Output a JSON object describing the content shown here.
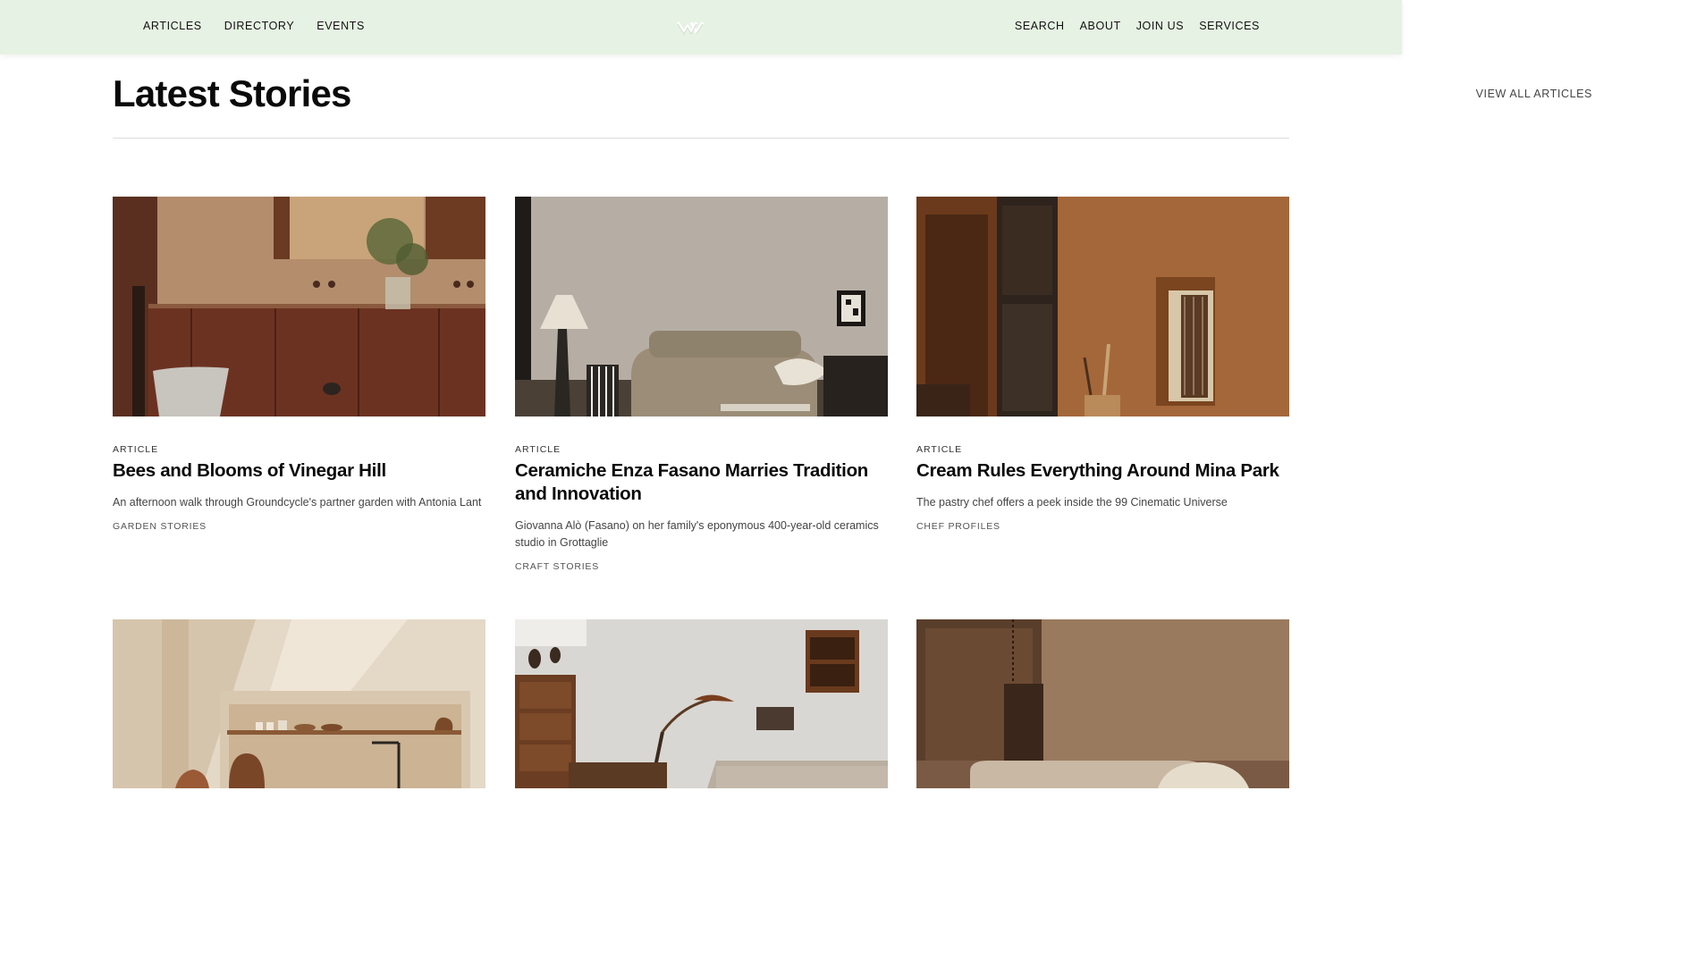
{
  "nav": {
    "left": [
      "ARTICLES",
      "DIRECTORY",
      "EVENTS"
    ],
    "right": [
      "SEARCH",
      "ABOUT",
      "JOIN US",
      "SERVICES"
    ],
    "logo_icon": "w-logo-icon",
    "bar_color": "#e6f2e3"
  },
  "header": {
    "title": "Latest Stories",
    "view_all": "VIEW ALL ARTICLES"
  },
  "cards": [
    {
      "kicker": "ARTICLE",
      "title": "Bees and Blooms of Vinegar Hill",
      "description": "An afternoon walk through Groundcycle's partner garden with Antonia Lant",
      "category": "GARDEN STORIES"
    },
    {
      "kicker": "ARTICLE",
      "title": "Ceramiche Enza Fasano Marries Tradition and Innovation",
      "description": "Giovanna Alò (Fasano) on her family's eponymous 400-year-old ceramics studio in Grottaglie",
      "category": "CRAFT STORIES"
    },
    {
      "kicker": "ARTICLE",
      "title": "Cream Rules Everything Around Mina Park",
      "description": "The pastry chef offers a peek inside the 99 Cinematic Universe",
      "category": "CHEF PROFILES"
    },
    {
      "kicker": "",
      "title": "",
      "description": "",
      "category": ""
    },
    {
      "kicker": "",
      "title": "",
      "description": "",
      "category": ""
    },
    {
      "kicker": "",
      "title": "",
      "description": "",
      "category": ""
    }
  ]
}
